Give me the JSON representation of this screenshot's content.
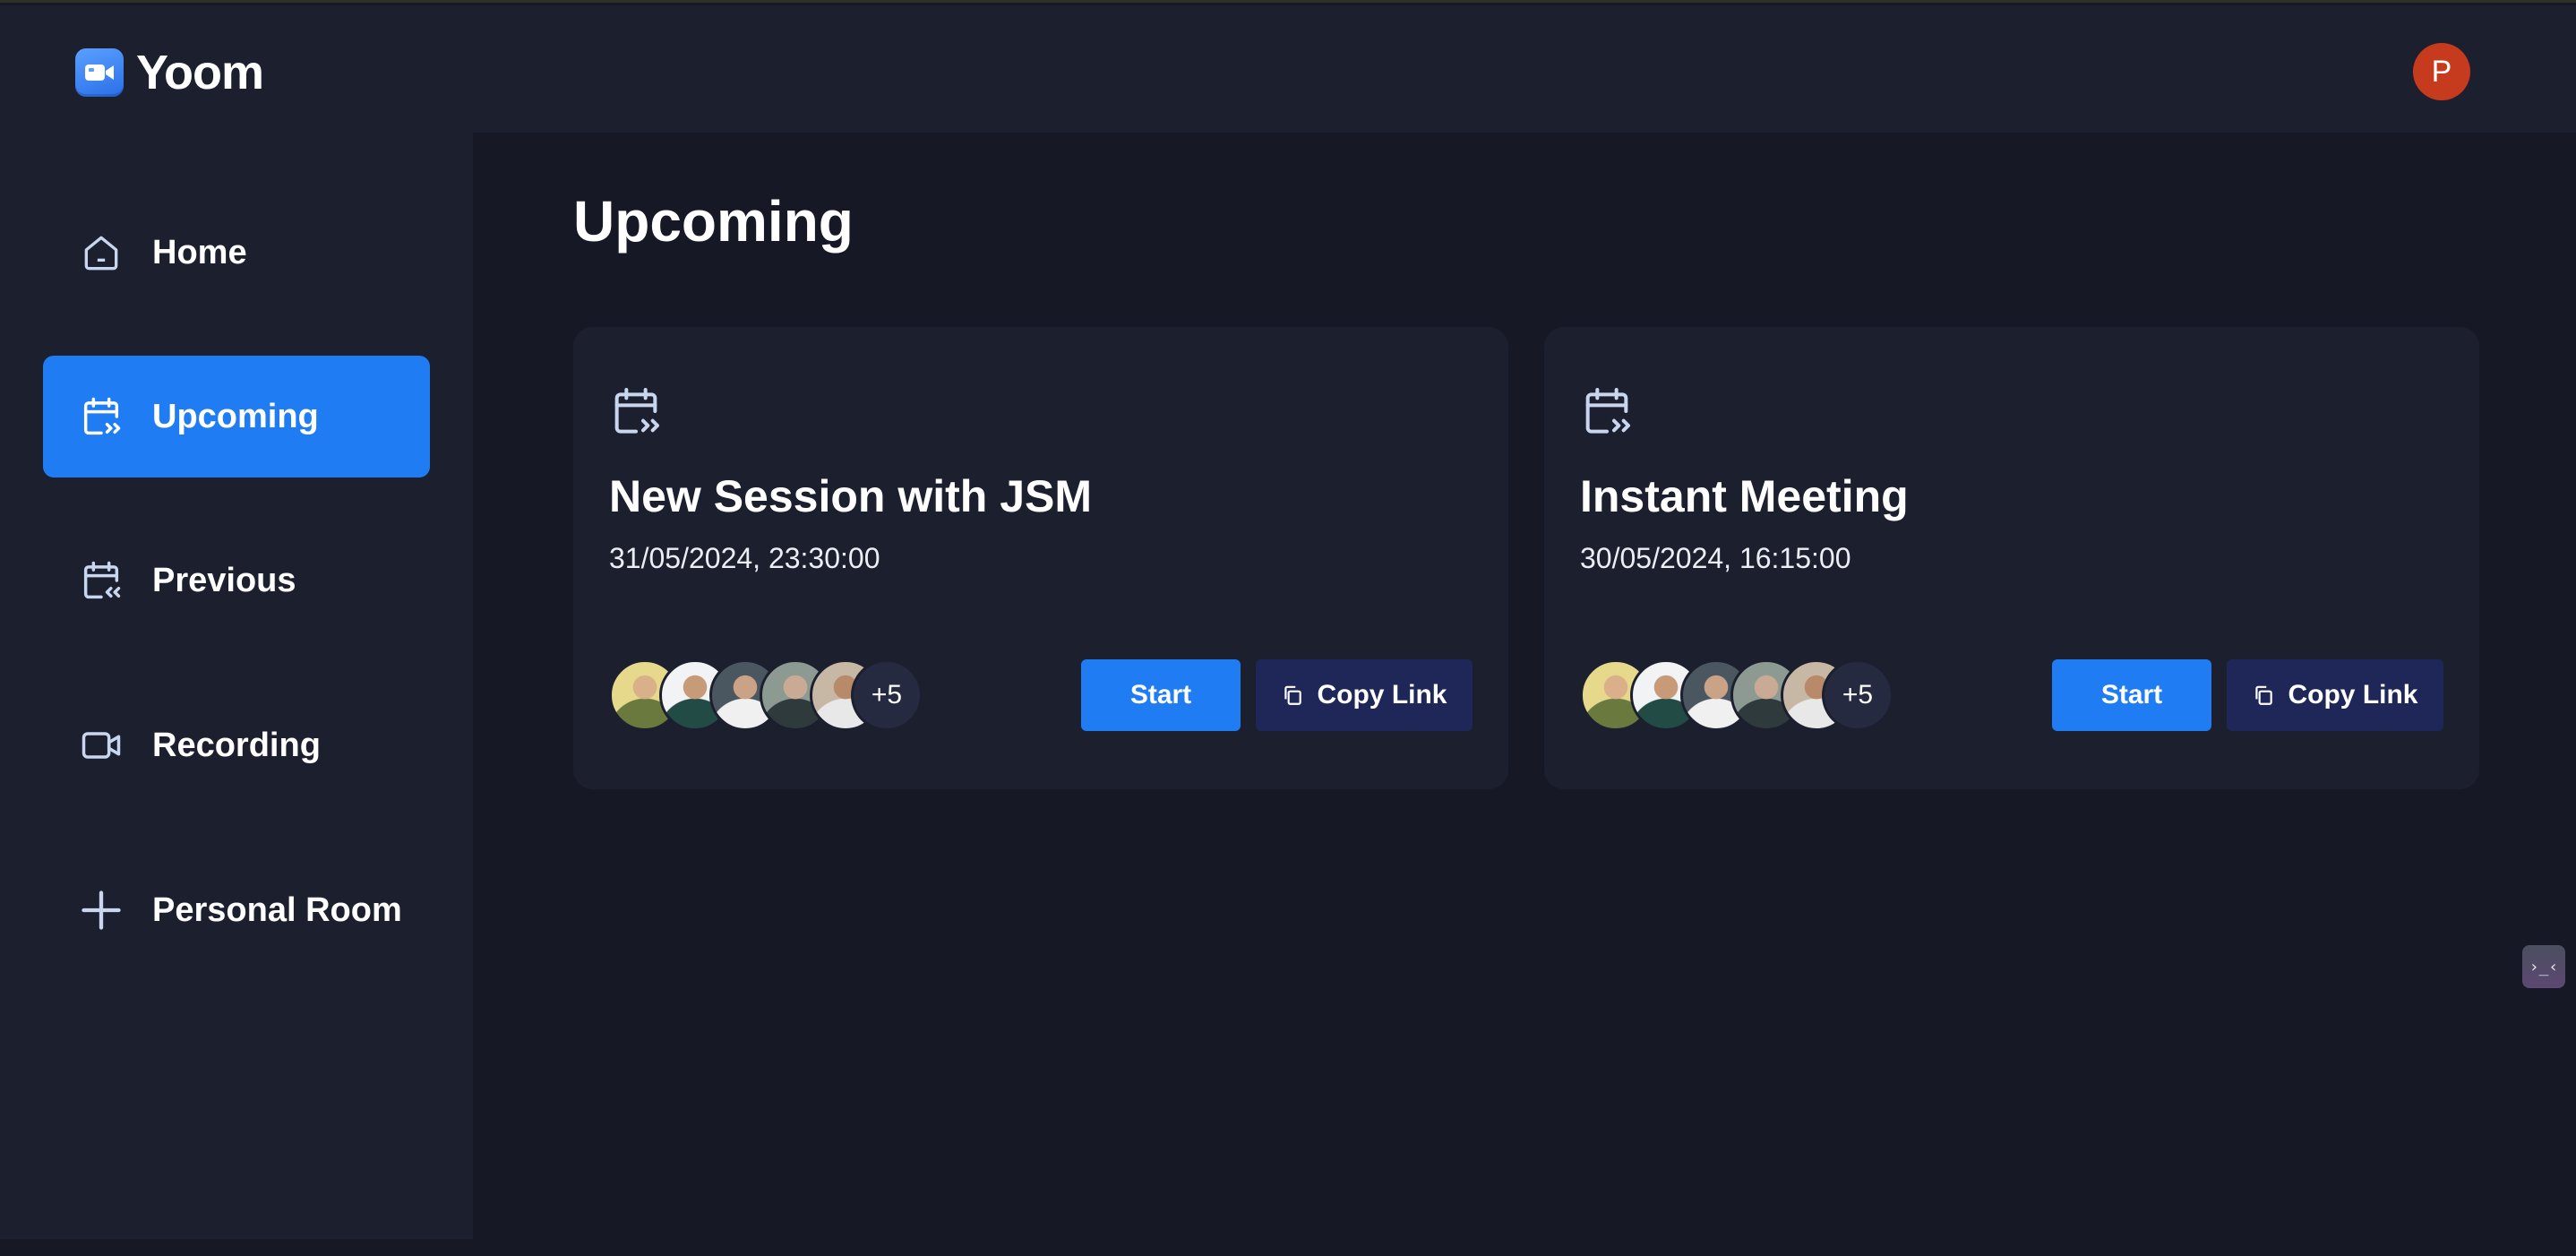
{
  "app": {
    "name": "Yoom",
    "logo_icon": "video-camera-icon",
    "user_initial": "P",
    "colors": {
      "accent": "#1f7cf2",
      "surface": "#1c1f2e",
      "background": "#161925",
      "secondary_button": "#1e2757",
      "avatar": "#c63b1e"
    }
  },
  "sidebar": {
    "items": [
      {
        "label": "Home",
        "icon": "home-icon",
        "active": false
      },
      {
        "label": "Upcoming",
        "icon": "calendar-upcoming-icon",
        "active": true
      },
      {
        "label": "Previous",
        "icon": "calendar-previous-icon",
        "active": false
      },
      {
        "label": "Recording",
        "icon": "video-icon",
        "active": false
      },
      {
        "label": "Personal Room",
        "icon": "plus-icon",
        "active": false
      }
    ]
  },
  "main": {
    "title": "Upcoming",
    "meetings": [
      {
        "title": "New Session with JSM",
        "datetime": "31/05/2024, 23:30:00",
        "icon": "calendar-upcoming-icon",
        "extra_attendees": "+5",
        "start_label": "Start",
        "copy_label": "Copy Link"
      },
      {
        "title": "Instant Meeting",
        "datetime": "30/05/2024, 16:15:00",
        "icon": "calendar-upcoming-icon",
        "extra_attendees": "+5",
        "start_label": "Start",
        "copy_label": "Copy Link"
      }
    ]
  },
  "widget": {
    "glyph": "›_‹",
    "icon": "dev-tools-icon"
  }
}
